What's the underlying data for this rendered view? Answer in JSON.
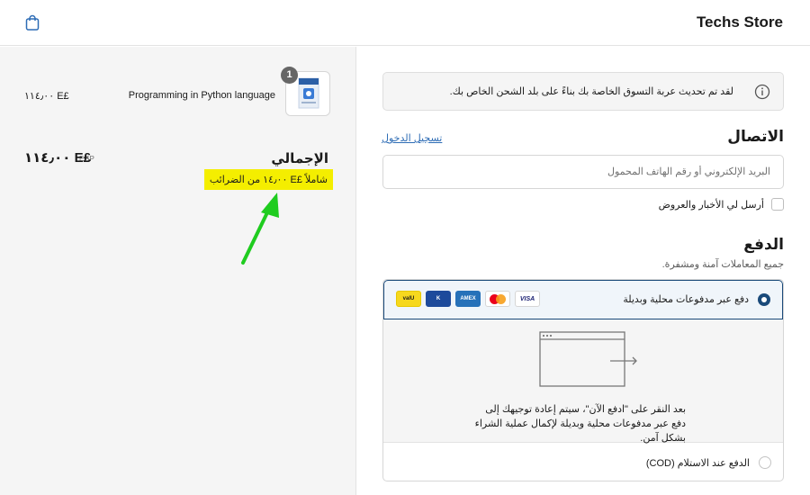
{
  "header": {
    "store_name": "Techs Store"
  },
  "summary": {
    "item": {
      "quantity": "1",
      "name": "Programming in Python language",
      "price": "£E ١١٤٫٠٠"
    },
    "total_label": "الإجمالي",
    "total_currency": "EGP",
    "total_amount": "£E ١١٤٫٠٠",
    "tax_note": "شاملاً £E ١٤٫٠٠ من الضرائب"
  },
  "notice": {
    "text": "لقد تم تحديث عربة التسوق الخاصة بك بناءً على بلد الشحن الخاص بك."
  },
  "contact": {
    "title": "الاتصال",
    "login_link": "تسجيل الدخول",
    "email_placeholder": "البريد الإلكتروني أو رقم الهاتف المحمول",
    "newsletter_label": "أرسل لي الأخبار والعروض"
  },
  "payment": {
    "title": "الدفع",
    "subtitle": "جميع المعاملات آمنة ومشفرة.",
    "option1_label": "دفع عبر مدفوعات محلية وبديلة",
    "cards": {
      "visa": "VISA",
      "amex": "AMEX",
      "knet": "K",
      "valu": "valU"
    },
    "redirect_text": "بعد النقر على \"ادفع الآن\"، سيتم إعادة توجيهك إلى دفع عبر مدفوعات محلية وبديلة لإكمال عملية الشراء بشكل آمن.",
    "option2_label": "الدفع عند الاستلام (COD)"
  },
  "colors": {
    "accent": "#1a4a7a",
    "highlight": "#f4ee00",
    "link": "#2d6cb5",
    "annotation_arrow": "#1fcc1f"
  }
}
